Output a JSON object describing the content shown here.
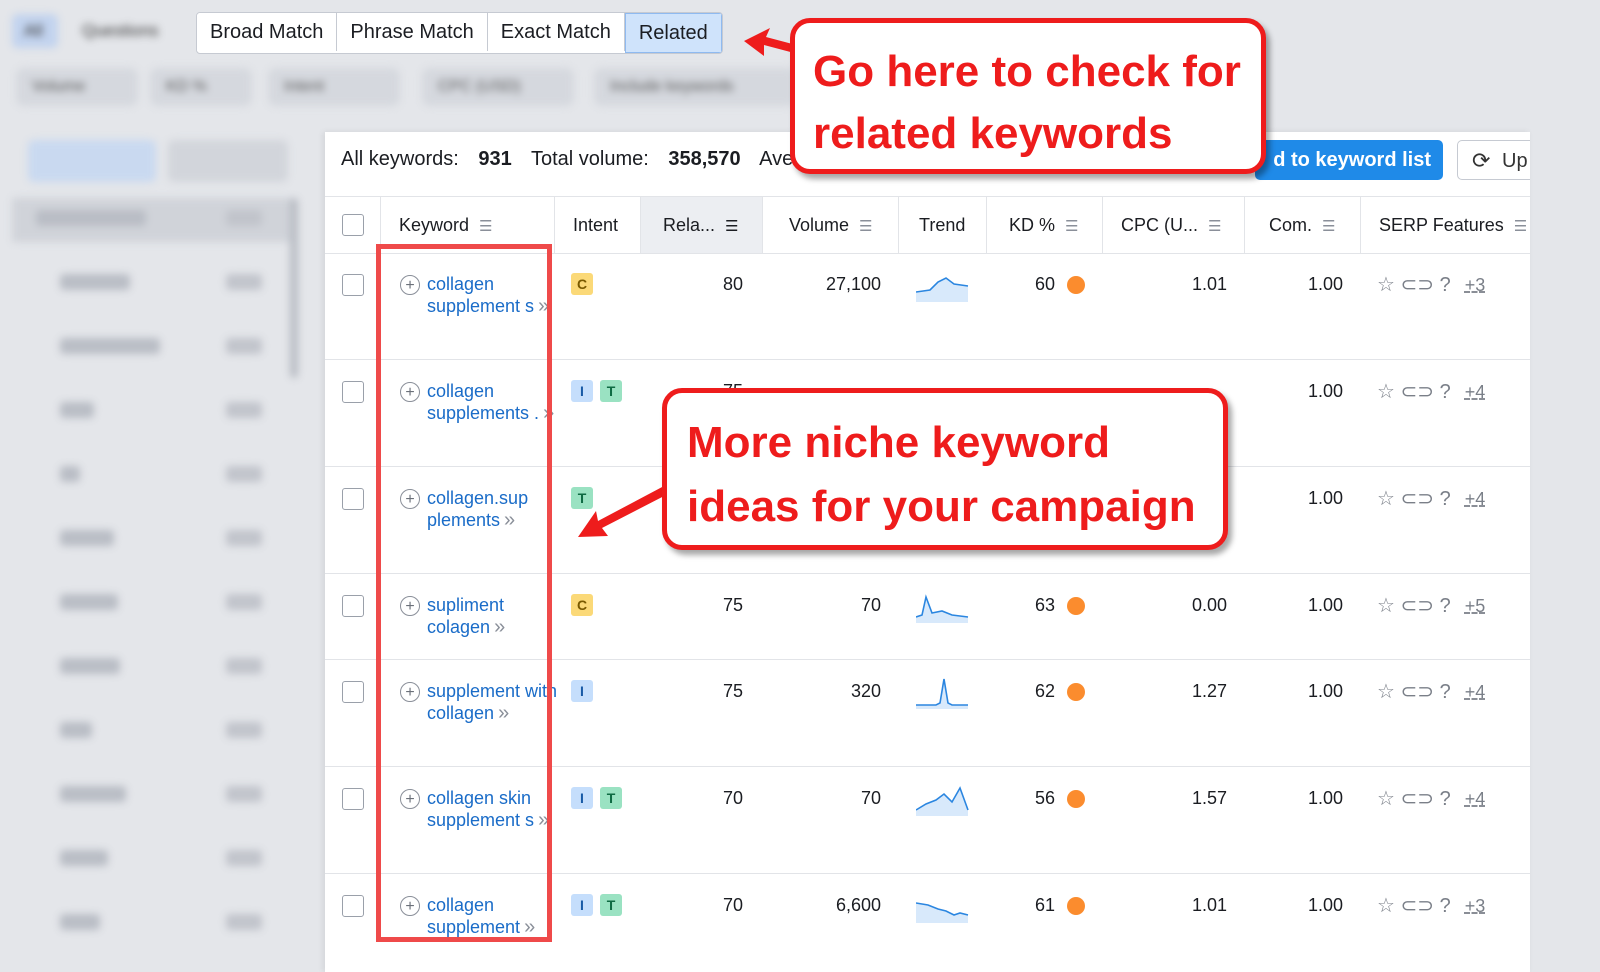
{
  "top_tabs": {
    "left_tab": "All",
    "questions_tab": "Questions",
    "match_tabs": [
      "Broad Match",
      "Phrase Match",
      "Exact Match",
      "Related"
    ],
    "active_tab": "Related"
  },
  "filters": [
    "Volume",
    "KD %",
    "Intent",
    "CPC (USD)",
    "Include keywords"
  ],
  "sidebar": {
    "toggle": [
      "By number",
      "By volume"
    ],
    "items": [
      "All keywords",
      "collagen",
      "supplements",
      "best",
      "uk",
      "review",
      "marine",
      "powder",
      "skin",
      "benefits",
      "tablets",
      "joints"
    ]
  },
  "stats": {
    "all_keywords_label": "All keywords:",
    "all_keywords_value": "931",
    "total_volume_label": "Total volume:",
    "total_volume_value": "358,570",
    "avg_label": "Ave"
  },
  "buttons": {
    "add_to_list": "d to keyword list",
    "update": "Up"
  },
  "columns": [
    "Keyword",
    "Intent",
    "Rela...",
    "Volume",
    "Trend",
    "KD %",
    "CPC (U...",
    "Com.",
    "SERP Features"
  ],
  "rows": [
    {
      "keyword": "collagen supplement s",
      "intent": [
        "C"
      ],
      "related": "80",
      "volume": "27,100",
      "kd": "60",
      "cpc": "1.01",
      "com": "1.00",
      "serp_more": "+3"
    },
    {
      "keyword": "collagen supplements .",
      "intent": [
        "I",
        "T"
      ],
      "related": "75",
      "volume": "",
      "kd": "",
      "cpc": "",
      "com": "1.00",
      "serp_more": "+4"
    },
    {
      "keyword": "collagen.sup plements",
      "intent": [
        "T"
      ],
      "related": "",
      "volume": "",
      "kd": "",
      "cpc": "",
      "com": "1.00",
      "serp_more": "+4"
    },
    {
      "keyword": "supliment colagen",
      "intent": [
        "C"
      ],
      "related": "75",
      "volume": "70",
      "kd": "63",
      "cpc": "0.00",
      "com": "1.00",
      "serp_more": "+5"
    },
    {
      "keyword": "supplement with collagen",
      "intent": [
        "I"
      ],
      "related": "75",
      "volume": "320",
      "kd": "62",
      "cpc": "1.27",
      "com": "1.00",
      "serp_more": "+4"
    },
    {
      "keyword": "collagen skin supplement s",
      "intent": [
        "I",
        "T"
      ],
      "related": "70",
      "volume": "70",
      "kd": "56",
      "cpc": "1.57",
      "com": "1.00",
      "serp_more": "+4"
    },
    {
      "keyword": "collagen supplement",
      "intent": [
        "I",
        "T"
      ],
      "related": "70",
      "volume": "6,600",
      "kd": "61",
      "cpc": "1.01",
      "com": "1.00",
      "serp_more": "+3"
    }
  ],
  "callouts": {
    "related": [
      "Go here to check for",
      "related keywords"
    ],
    "niche": [
      "More niche keyword",
      "ideas for your campaign"
    ]
  },
  "colors": {
    "callout_red": "#ee1c1c",
    "link_blue": "#1a6cc8",
    "primary_blue": "#1f8ae8",
    "kd_orange": "#fb8c2e"
  }
}
